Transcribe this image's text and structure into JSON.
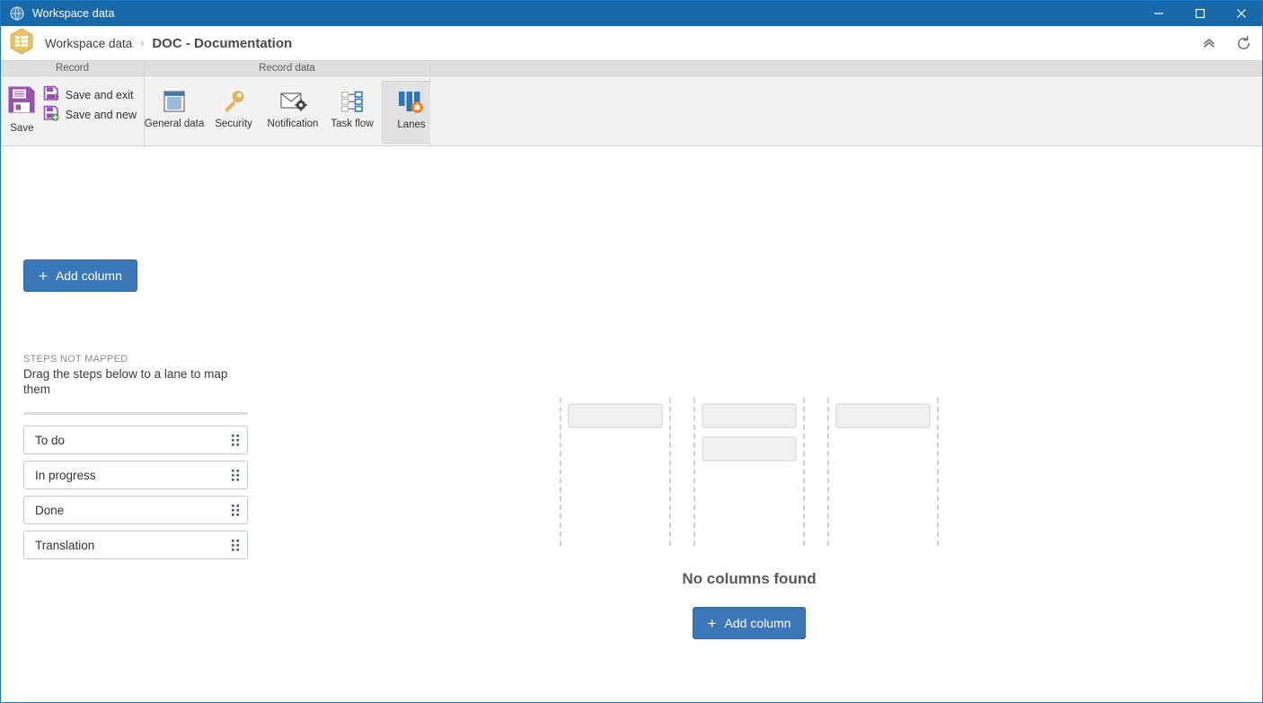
{
  "window": {
    "title": "Workspace data",
    "app_icon": "globe-icon",
    "controls": {
      "minimize": "minimize-icon",
      "maximize": "maximize-icon",
      "close": "close-icon"
    }
  },
  "breadcrumb": {
    "icon": "workspace-hexagon-icon",
    "root": "Workspace data",
    "separator": "›",
    "current": "DOC - Documentation",
    "actions": [
      {
        "name": "collapse-ribbon-icon",
        "glyph": "«"
      },
      {
        "name": "refresh-icon",
        "glyph": "⟳"
      }
    ]
  },
  "ribbon": {
    "groups": [
      {
        "label": "Record",
        "big_button": {
          "label": "Save",
          "icon": "save-floppy-icon"
        },
        "small_buttons": [
          {
            "label": "Save and exit",
            "icon": "save-and-exit-icon"
          },
          {
            "label": "Save and new",
            "icon": "save-and-new-icon"
          }
        ]
      },
      {
        "label": "Record data",
        "items": [
          {
            "label": "General data",
            "icon": "document-lines-icon",
            "active": false
          },
          {
            "label": "Security",
            "icon": "key-icon",
            "active": false
          },
          {
            "label": "Notification",
            "icon": "envelope-gear-icon",
            "active": false
          },
          {
            "label": "Task flow",
            "icon": "task-flow-icon",
            "active": false
          },
          {
            "label": "Lanes",
            "icon": "lanes-bars-icon",
            "active": true
          }
        ]
      },
      {
        "label": "",
        "items": []
      }
    ]
  },
  "main": {
    "add_column_top": {
      "label": "Add column",
      "icon": "plus-icon"
    },
    "steps_panel": {
      "caption": "STEPS NOT MAPPED",
      "help_text": "Drag the steps below to a lane to map them",
      "steps": [
        {
          "label": "To do",
          "handle": "drag-handle-icon"
        },
        {
          "label": "In progress",
          "handle": "drag-handle-icon"
        },
        {
          "label": "Done",
          "handle": "drag-handle-icon"
        },
        {
          "label": "Translation",
          "handle": "drag-handle-icon"
        }
      ]
    },
    "empty_state": {
      "title": "No columns found",
      "add_column": {
        "label": "Add column",
        "icon": "plus-icon"
      },
      "ghost_columns": [
        {
          "cards": 1
        },
        {
          "cards": 2
        },
        {
          "cards": 1
        }
      ]
    }
  },
  "colors": {
    "titlebar": "#1769aa",
    "window_border": "#1a7ac4",
    "primary_button": "#3a76b8",
    "ribbon_bg": "#f2f2f2",
    "ribbon_group_header": "#dedede",
    "save_icon": "#8e4fa8",
    "security_icon": "#e0b354",
    "lanes_icon": "#2e75b6",
    "lanes_badge": "#f07d20"
  }
}
